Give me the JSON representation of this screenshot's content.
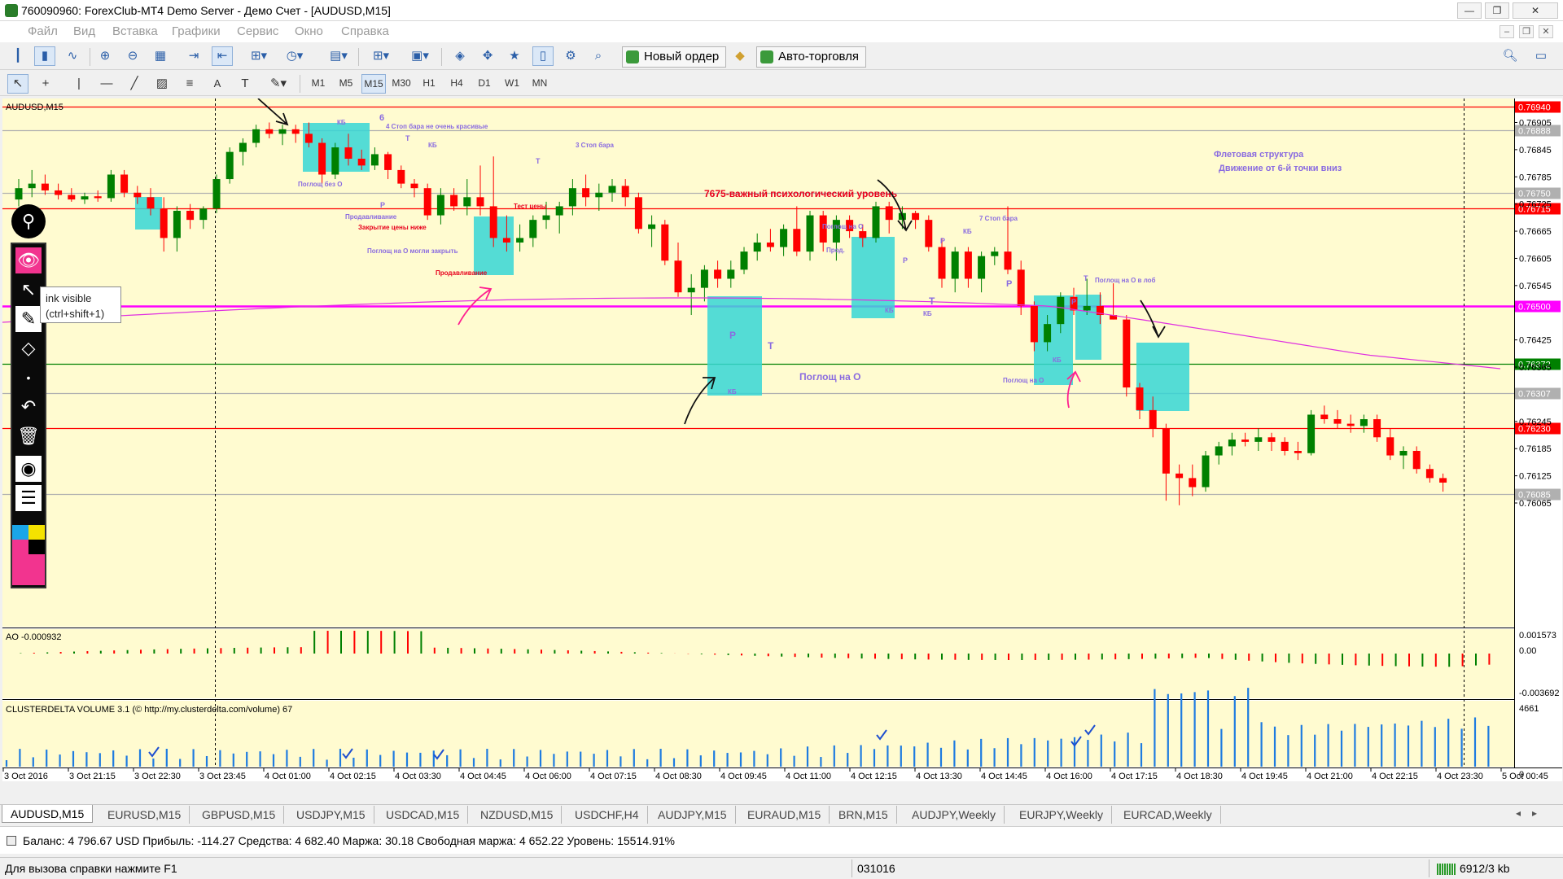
{
  "window": {
    "title": "760090960: ForexClub-MT4 Demo Server - Демо Счет - [AUDUSD,M15]"
  },
  "menu": [
    "Файл",
    "Вид",
    "Вставка",
    "Графики",
    "Сервис",
    "Окно",
    "Справка"
  ],
  "toolbar": {
    "new_order": "Новый ордер",
    "auto_trading": "Авто-торговля"
  },
  "timeframes": [
    "M1",
    "M5",
    "M15",
    "M30",
    "H1",
    "H4",
    "D1",
    "W1",
    "MN"
  ],
  "active_timeframe": "M15",
  "chart": {
    "symbol_label": "AUDUSD,M15",
    "price_labels": [
      "0.76905",
      "0.76845",
      "0.76785",
      "0.76725",
      "0.76665",
      "0.76605",
      "0.76545",
      "0.76425",
      "0.76365",
      "0.76245",
      "0.76185",
      "0.76125",
      "0.76065"
    ],
    "level_labels": [
      {
        "price": "0.76940",
        "color": "#ff0000"
      },
      {
        "price": "0.76888",
        "color": "#b0b0b0"
      },
      {
        "price": "0.76750",
        "color": "#b0b0b0"
      },
      {
        "price": "0.76715",
        "color": "#ff0000"
      },
      {
        "price": "0.76500",
        "color": "#ff00ff"
      },
      {
        "price": "0.76372",
        "color": "#008000"
      },
      {
        "price": "0.76307",
        "color": "#b0b0b0"
      },
      {
        "price": "0.76230",
        "color": "#ff0000"
      },
      {
        "price": "0.76085",
        "color": "#b0b0b0"
      }
    ],
    "time_labels": [
      "3 Oct 2016",
      "3 Oct 21:15",
      "3 Oct 22:30",
      "3 Oct 23:45",
      "4 Oct 01:00",
      "4 Oct 02:15",
      "4 Oct 03:30",
      "4 Oct 04:45",
      "4 Oct 06:00",
      "4 Oct 07:15",
      "4 Oct 08:30",
      "4 Oct 09:45",
      "4 Oct 11:00",
      "4 Oct 12:15",
      "4 Oct 13:30",
      "4 Oct 14:45",
      "4 Oct 16:00",
      "4 Oct 17:15",
      "4 Oct 18:30",
      "4 Oct 19:45",
      "4 Oct 21:00",
      "4 Oct 22:15",
      "4 Oct 23:30",
      "5 Oct 00:45"
    ],
    "annotations": {
      "level_7675": "7675-важный психологический уровень",
      "flat_1": "Флетовая структура",
      "flat_2": "Движение от 6-й точки вниз",
      "engulf_0_main": "Поглощ на О",
      "stop4": "4 Стоп бара не очень красивые",
      "stop3": "3 Стоп бара",
      "stop7": "7 Стоп бара",
      "engulf_no_o": "Поглощ без О",
      "push1": "Продавливание",
      "close_lower": "Закрытие цены ниже",
      "engulf_could": "Поглощ на О могли закрыть",
      "push2": "Продавливание",
      "price_test": "Тест цены",
      "engulf_o1": "Поглощ на О",
      "prod": "Прод.",
      "engulf_o2": "Поглощ на О",
      "engulf_forehead": "Поглощ на О в лоб",
      "n6": "6",
      "kb": "КБ",
      "t": "Т",
      "p": "Р"
    },
    "ao": {
      "label": "AO -0.000932",
      "scale_top": "0.001573",
      "scale_mid": "0.00",
      "scale_bot": "-0.003692"
    },
    "volume": {
      "label": "CLUSTERDELTA VOLUME 3.1 (© http://my.clusterdelta.com/volume) 67",
      "scale_top": "4661",
      "scale_bot": "0"
    },
    "colors": {
      "bg": "#fffbd0",
      "bull": "#008000",
      "bear": "#ff0000",
      "highlight": "#36d6d6",
      "magenta": "#ff00cc",
      "anno": "#8a6be0",
      "anno_red": "#e8001c"
    }
  },
  "ink": {
    "tooltip_line1": "ink visible",
    "tooltip_line2": "(ctrl+shift+1)"
  },
  "tabs": [
    "AUDUSD,M15",
    "EURUSD,M15",
    "GBPUSD,M15",
    "USDJPY,M15",
    "USDCAD,M15",
    "NZDUSD,M15",
    "USDCHF,H4",
    "AUDJPY,M15",
    "EURAUD,M15",
    "BRN,M15",
    "AUDJPY,Weekly",
    "EURJPY,Weekly",
    "EURCAD,Weekly"
  ],
  "account": {
    "text": "Баланс: 4 796.67 USD  Прибыль: -114.27  Средства: 4 682.40  Маржа: 30.18  Свободная маржа: 4 652.22  Уровень: 15514.91%"
  },
  "status": {
    "help": "Для вызова справки нажмите F1",
    "date_code": "031016",
    "traffic": "6912/3 kb"
  }
}
